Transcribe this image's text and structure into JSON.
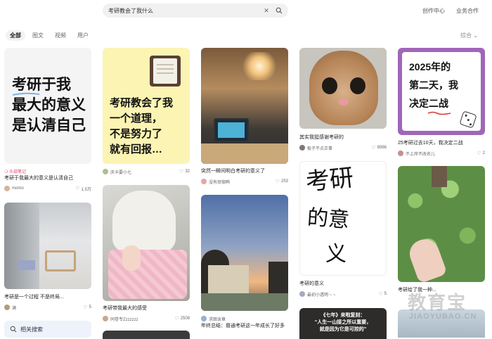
{
  "search": {
    "query": "考研教会了我什么"
  },
  "toplinks": {
    "creator": "创作中心",
    "business": "业务合作"
  },
  "tabs": [
    {
      "label": "全部"
    },
    {
      "label": "图文"
    },
    {
      "label": "视频"
    },
    {
      "label": "用户"
    }
  ],
  "sort": {
    "label": "综合"
  },
  "cards": {
    "c1": {
      "lines": [
        "考研于我",
        "最大的意义",
        "是认清自己"
      ],
      "tag": "头部笔记",
      "title": "考研于我最大的意义是认清自己",
      "author": "momo",
      "likes": "1.5万"
    },
    "c2": {
      "title": "考研是一个过程 不是终局...",
      "author": "满",
      "likes": "5"
    },
    "c3": {
      "lines": [
        "考研教会了我",
        "一个道理，",
        "不是努力了",
        "就有回报…"
      ],
      "title": "",
      "author": "庆卡要小七",
      "likes": "32"
    },
    "c4": {
      "title": "考研带我最大的感受",
      "author": "同卷专Zzzzzzz",
      "likes": "2508"
    },
    "c5": {
      "title": "突然一瞬间明白考研的意义了",
      "author": "没有烦恼鸭",
      "likes": "253"
    },
    "c6": {
      "title": "年终总结：普通考研这一年成长了好多",
      "author": "求图含章"
    },
    "c7": {
      "title": "其实我挺感谢考研的",
      "author": "板子不点正事",
      "likes": "8986"
    },
    "c8": {
      "handwriting": [
        "考研",
        "的意",
        "义"
      ],
      "title": "考研的意义",
      "author": "最初小透明 ~ ~",
      "likes": "5"
    },
    "c9": {
      "title": "",
      "lines2": [
        "《七年》来啦复刻：",
        "“人生一山接之所以重要，",
        "就是因为它是可控的”"
      ]
    },
    "c10": {
      "lines": [
        "2025年的",
        "第二天，我",
        "决定二战"
      ],
      "title": "25考研过去10天，我决定二战",
      "author": "不上岸不改名儿",
      "likes": "2"
    },
    "c11": {
      "title": "考研给了我一种..."
    }
  },
  "related": {
    "label": "相关搜索"
  },
  "watermark": {
    "cn": "教育宝",
    "en": "JIAOYUBAO.CN"
  }
}
